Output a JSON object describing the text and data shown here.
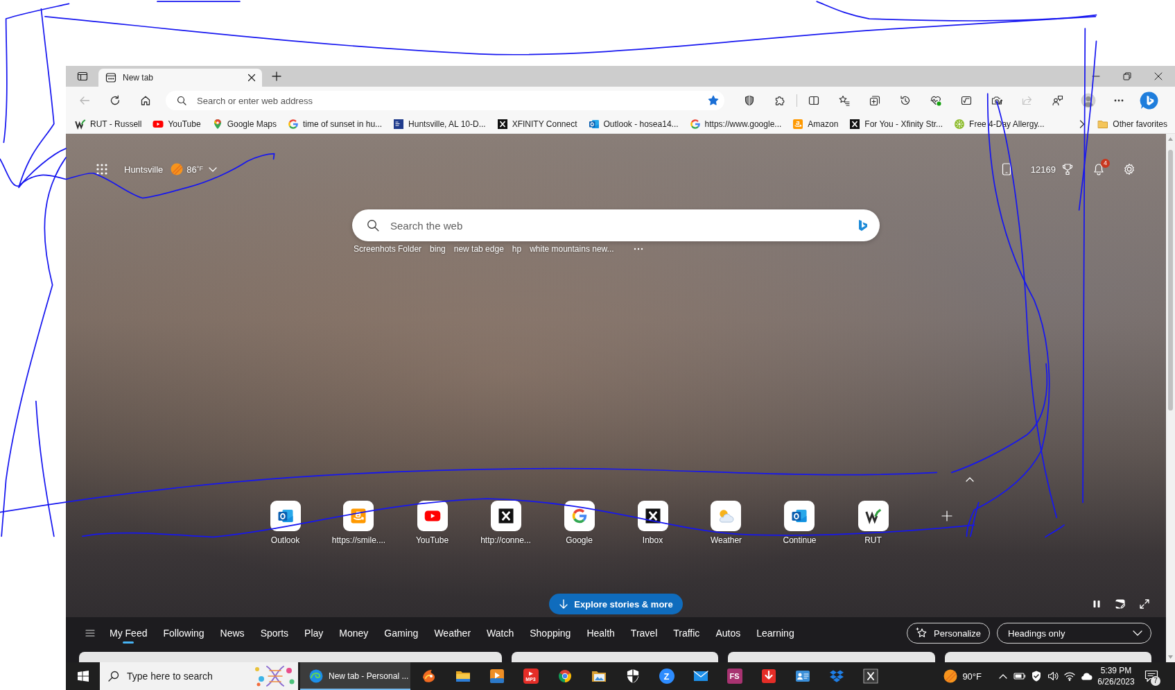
{
  "browser": {
    "tabs": [
      {
        "label": "New tab",
        "selected": true
      }
    ]
  },
  "toolbar": {
    "address_placeholder": "Search or enter web address",
    "favorited": true
  },
  "favorites_bar": {
    "items": [
      {
        "label": "RUT - Russell",
        "kind": "rut"
      },
      {
        "label": "YouTube",
        "kind": "youtube"
      },
      {
        "label": "Google Maps",
        "kind": "maps"
      },
      {
        "label": "time of sunset in hu...",
        "kind": "google"
      },
      {
        "label": "Huntsville, AL 10-D...",
        "kind": "channel"
      },
      {
        "label": "XFINITY Connect",
        "kind": "xfinity"
      },
      {
        "label": "Outlook - hosea14...",
        "kind": "outlook"
      },
      {
        "label": "https://www.google...",
        "kind": "google"
      },
      {
        "label": "Amazon",
        "kind": "amazon"
      },
      {
        "label": "For You - Xfinity Str...",
        "kind": "xfinity"
      },
      {
        "label": "Free 4-Day Allergy...",
        "kind": "leaf"
      }
    ],
    "other_favorites": "Other favorites"
  },
  "new_tab_page": {
    "weather": {
      "location": "Huntsville",
      "temperature": "86",
      "unit": "°F"
    },
    "rewards_points": "12169",
    "notification_count": "4",
    "search": {
      "placeholder": "Search the web"
    },
    "suggestions": [
      "Screenhots Folder",
      "bing",
      "new tab edge",
      "hp",
      "white mountains new..."
    ],
    "quick_links": [
      {
        "label": "Outlook",
        "kind": "outlook"
      },
      {
        "label": "https://smile....",
        "kind": "amazon"
      },
      {
        "label": "YouTube",
        "kind": "youtube"
      },
      {
        "label": "http://conne...",
        "kind": "xfinity"
      },
      {
        "label": "Google",
        "kind": "google"
      },
      {
        "label": "Inbox",
        "kind": "xfinity"
      },
      {
        "label": "Weather",
        "kind": "weather"
      },
      {
        "label": "Continue",
        "kind": "outlook"
      },
      {
        "label": "RUT",
        "kind": "rut"
      }
    ],
    "explore_button": "Explore stories & more",
    "feed_tabs": [
      {
        "label": "My Feed",
        "selected": true
      },
      {
        "label": "Following",
        "selected": false
      },
      {
        "label": "News",
        "selected": false
      },
      {
        "label": "Sports",
        "selected": false
      },
      {
        "label": "Play",
        "selected": false
      },
      {
        "label": "Money",
        "selected": false
      },
      {
        "label": "Gaming",
        "selected": false
      },
      {
        "label": "Weather",
        "selected": false
      },
      {
        "label": "Watch",
        "selected": false
      },
      {
        "label": "Shopping",
        "selected": false
      },
      {
        "label": "Health",
        "selected": false
      },
      {
        "label": "Travel",
        "selected": false
      },
      {
        "label": "Traffic",
        "selected": false
      },
      {
        "label": "Autos",
        "selected": false
      },
      {
        "label": "Learning",
        "selected": false
      }
    ],
    "personalize_button": "Personalize",
    "layout_select": "Headings only"
  },
  "taskbar": {
    "search_placeholder": "Type here to search",
    "windows": [
      {
        "label": "New tab - Personal ...",
        "selected": true
      }
    ],
    "pinned": [
      {
        "kind": "lion"
      },
      {
        "kind": "explorer"
      },
      {
        "kind": "video"
      },
      {
        "kind": "mp3",
        "label": "MP3"
      },
      {
        "kind": "chrome"
      },
      {
        "kind": "photos"
      },
      {
        "kind": "shield"
      },
      {
        "kind": "zoom",
        "label": "Z"
      },
      {
        "kind": "mail"
      },
      {
        "kind": "fs",
        "label": "FS"
      },
      {
        "kind": "download"
      },
      {
        "kind": "contacts"
      },
      {
        "kind": "dropbox"
      },
      {
        "kind": "xtile"
      }
    ],
    "weather": "90°F",
    "time": "5:39 PM",
    "date": "6/26/2023",
    "notification_count": "7"
  }
}
